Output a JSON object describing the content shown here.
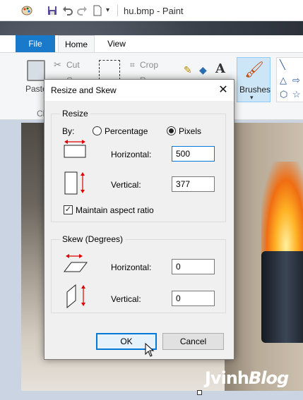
{
  "paint": {
    "window_title": "hu.bmp - Paint",
    "tabs": [
      "File",
      "Home",
      "View"
    ],
    "ribbon": {
      "paste": "Paste",
      "cut": "Cut",
      "copy": "C",
      "clipboard": "Cl",
      "crop": "Crop",
      "resize": "R",
      "brushes": "Brushes"
    }
  },
  "dialog": {
    "title": "Resize and Skew",
    "close": "✕",
    "resize": {
      "group_label": "Resize",
      "by_label": "By:",
      "option_percentage": "Percentage",
      "option_pixels": "Pixels",
      "selected": "Pixels",
      "horizontal_label": "Horizontal:",
      "horizontal_value": "500",
      "vertical_label": "Vertical:",
      "vertical_value": "377",
      "maintain_aspect_label": "Maintain aspect ratio",
      "maintain_aspect_checked": true
    },
    "skew": {
      "group_label": "Skew (Degrees)",
      "horizontal_label": "Horizontal:",
      "horizontal_value": "0",
      "vertical_label": "Vertical:",
      "vertical_value": "0"
    },
    "ok_label": "OK",
    "cancel_label": "Cancel"
  },
  "watermark": {
    "part1": "Jvinh",
    "part2": "Blog"
  },
  "colors": {
    "accent": "#0078d7",
    "file_tab": "#1979ca",
    "arrow_red": "#e00000"
  }
}
